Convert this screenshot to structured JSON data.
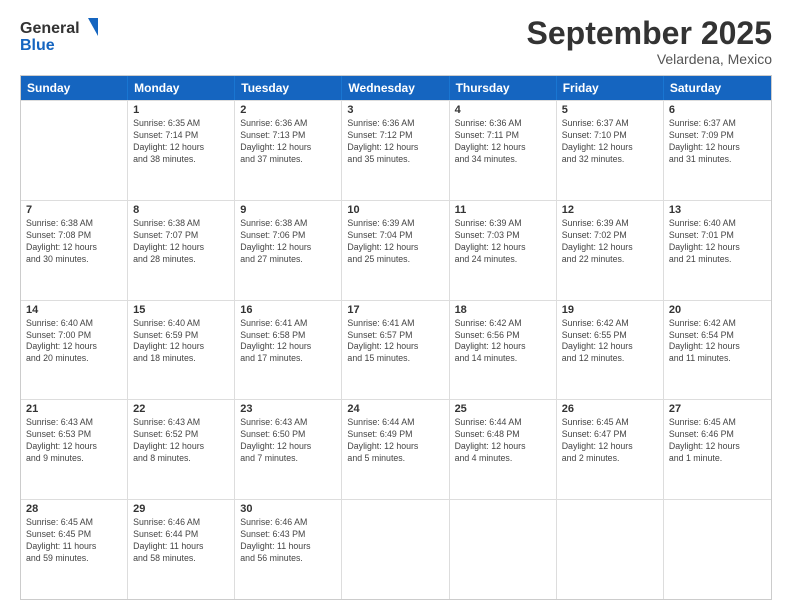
{
  "header": {
    "logo_general": "General",
    "logo_blue": "Blue",
    "month_title": "September 2025",
    "subtitle": "Velardena, Mexico"
  },
  "days_of_week": [
    "Sunday",
    "Monday",
    "Tuesday",
    "Wednesday",
    "Thursday",
    "Friday",
    "Saturday"
  ],
  "weeks": [
    [
      {
        "day": "",
        "lines": []
      },
      {
        "day": "1",
        "lines": [
          "Sunrise: 6:35 AM",
          "Sunset: 7:14 PM",
          "Daylight: 12 hours",
          "and 38 minutes."
        ]
      },
      {
        "day": "2",
        "lines": [
          "Sunrise: 6:36 AM",
          "Sunset: 7:13 PM",
          "Daylight: 12 hours",
          "and 37 minutes."
        ]
      },
      {
        "day": "3",
        "lines": [
          "Sunrise: 6:36 AM",
          "Sunset: 7:12 PM",
          "Daylight: 12 hours",
          "and 35 minutes."
        ]
      },
      {
        "day": "4",
        "lines": [
          "Sunrise: 6:36 AM",
          "Sunset: 7:11 PM",
          "Daylight: 12 hours",
          "and 34 minutes."
        ]
      },
      {
        "day": "5",
        "lines": [
          "Sunrise: 6:37 AM",
          "Sunset: 7:10 PM",
          "Daylight: 12 hours",
          "and 32 minutes."
        ]
      },
      {
        "day": "6",
        "lines": [
          "Sunrise: 6:37 AM",
          "Sunset: 7:09 PM",
          "Daylight: 12 hours",
          "and 31 minutes."
        ]
      }
    ],
    [
      {
        "day": "7",
        "lines": [
          "Sunrise: 6:38 AM",
          "Sunset: 7:08 PM",
          "Daylight: 12 hours",
          "and 30 minutes."
        ]
      },
      {
        "day": "8",
        "lines": [
          "Sunrise: 6:38 AM",
          "Sunset: 7:07 PM",
          "Daylight: 12 hours",
          "and 28 minutes."
        ]
      },
      {
        "day": "9",
        "lines": [
          "Sunrise: 6:38 AM",
          "Sunset: 7:06 PM",
          "Daylight: 12 hours",
          "and 27 minutes."
        ]
      },
      {
        "day": "10",
        "lines": [
          "Sunrise: 6:39 AM",
          "Sunset: 7:04 PM",
          "Daylight: 12 hours",
          "and 25 minutes."
        ]
      },
      {
        "day": "11",
        "lines": [
          "Sunrise: 6:39 AM",
          "Sunset: 7:03 PM",
          "Daylight: 12 hours",
          "and 24 minutes."
        ]
      },
      {
        "day": "12",
        "lines": [
          "Sunrise: 6:39 AM",
          "Sunset: 7:02 PM",
          "Daylight: 12 hours",
          "and 22 minutes."
        ]
      },
      {
        "day": "13",
        "lines": [
          "Sunrise: 6:40 AM",
          "Sunset: 7:01 PM",
          "Daylight: 12 hours",
          "and 21 minutes."
        ]
      }
    ],
    [
      {
        "day": "14",
        "lines": [
          "Sunrise: 6:40 AM",
          "Sunset: 7:00 PM",
          "Daylight: 12 hours",
          "and 20 minutes."
        ]
      },
      {
        "day": "15",
        "lines": [
          "Sunrise: 6:40 AM",
          "Sunset: 6:59 PM",
          "Daylight: 12 hours",
          "and 18 minutes."
        ]
      },
      {
        "day": "16",
        "lines": [
          "Sunrise: 6:41 AM",
          "Sunset: 6:58 PM",
          "Daylight: 12 hours",
          "and 17 minutes."
        ]
      },
      {
        "day": "17",
        "lines": [
          "Sunrise: 6:41 AM",
          "Sunset: 6:57 PM",
          "Daylight: 12 hours",
          "and 15 minutes."
        ]
      },
      {
        "day": "18",
        "lines": [
          "Sunrise: 6:42 AM",
          "Sunset: 6:56 PM",
          "Daylight: 12 hours",
          "and 14 minutes."
        ]
      },
      {
        "day": "19",
        "lines": [
          "Sunrise: 6:42 AM",
          "Sunset: 6:55 PM",
          "Daylight: 12 hours",
          "and 12 minutes."
        ]
      },
      {
        "day": "20",
        "lines": [
          "Sunrise: 6:42 AM",
          "Sunset: 6:54 PM",
          "Daylight: 12 hours",
          "and 11 minutes."
        ]
      }
    ],
    [
      {
        "day": "21",
        "lines": [
          "Sunrise: 6:43 AM",
          "Sunset: 6:53 PM",
          "Daylight: 12 hours",
          "and 9 minutes."
        ]
      },
      {
        "day": "22",
        "lines": [
          "Sunrise: 6:43 AM",
          "Sunset: 6:52 PM",
          "Daylight: 12 hours",
          "and 8 minutes."
        ]
      },
      {
        "day": "23",
        "lines": [
          "Sunrise: 6:43 AM",
          "Sunset: 6:50 PM",
          "Daylight: 12 hours",
          "and 7 minutes."
        ]
      },
      {
        "day": "24",
        "lines": [
          "Sunrise: 6:44 AM",
          "Sunset: 6:49 PM",
          "Daylight: 12 hours",
          "and 5 minutes."
        ]
      },
      {
        "day": "25",
        "lines": [
          "Sunrise: 6:44 AM",
          "Sunset: 6:48 PM",
          "Daylight: 12 hours",
          "and 4 minutes."
        ]
      },
      {
        "day": "26",
        "lines": [
          "Sunrise: 6:45 AM",
          "Sunset: 6:47 PM",
          "Daylight: 12 hours",
          "and 2 minutes."
        ]
      },
      {
        "day": "27",
        "lines": [
          "Sunrise: 6:45 AM",
          "Sunset: 6:46 PM",
          "Daylight: 12 hours",
          "and 1 minute."
        ]
      }
    ],
    [
      {
        "day": "28",
        "lines": [
          "Sunrise: 6:45 AM",
          "Sunset: 6:45 PM",
          "Daylight: 11 hours",
          "and 59 minutes."
        ]
      },
      {
        "day": "29",
        "lines": [
          "Sunrise: 6:46 AM",
          "Sunset: 6:44 PM",
          "Daylight: 11 hours",
          "and 58 minutes."
        ]
      },
      {
        "day": "30",
        "lines": [
          "Sunrise: 6:46 AM",
          "Sunset: 6:43 PM",
          "Daylight: 11 hours",
          "and 56 minutes."
        ]
      },
      {
        "day": "",
        "lines": []
      },
      {
        "day": "",
        "lines": []
      },
      {
        "day": "",
        "lines": []
      },
      {
        "day": "",
        "lines": []
      }
    ]
  ]
}
